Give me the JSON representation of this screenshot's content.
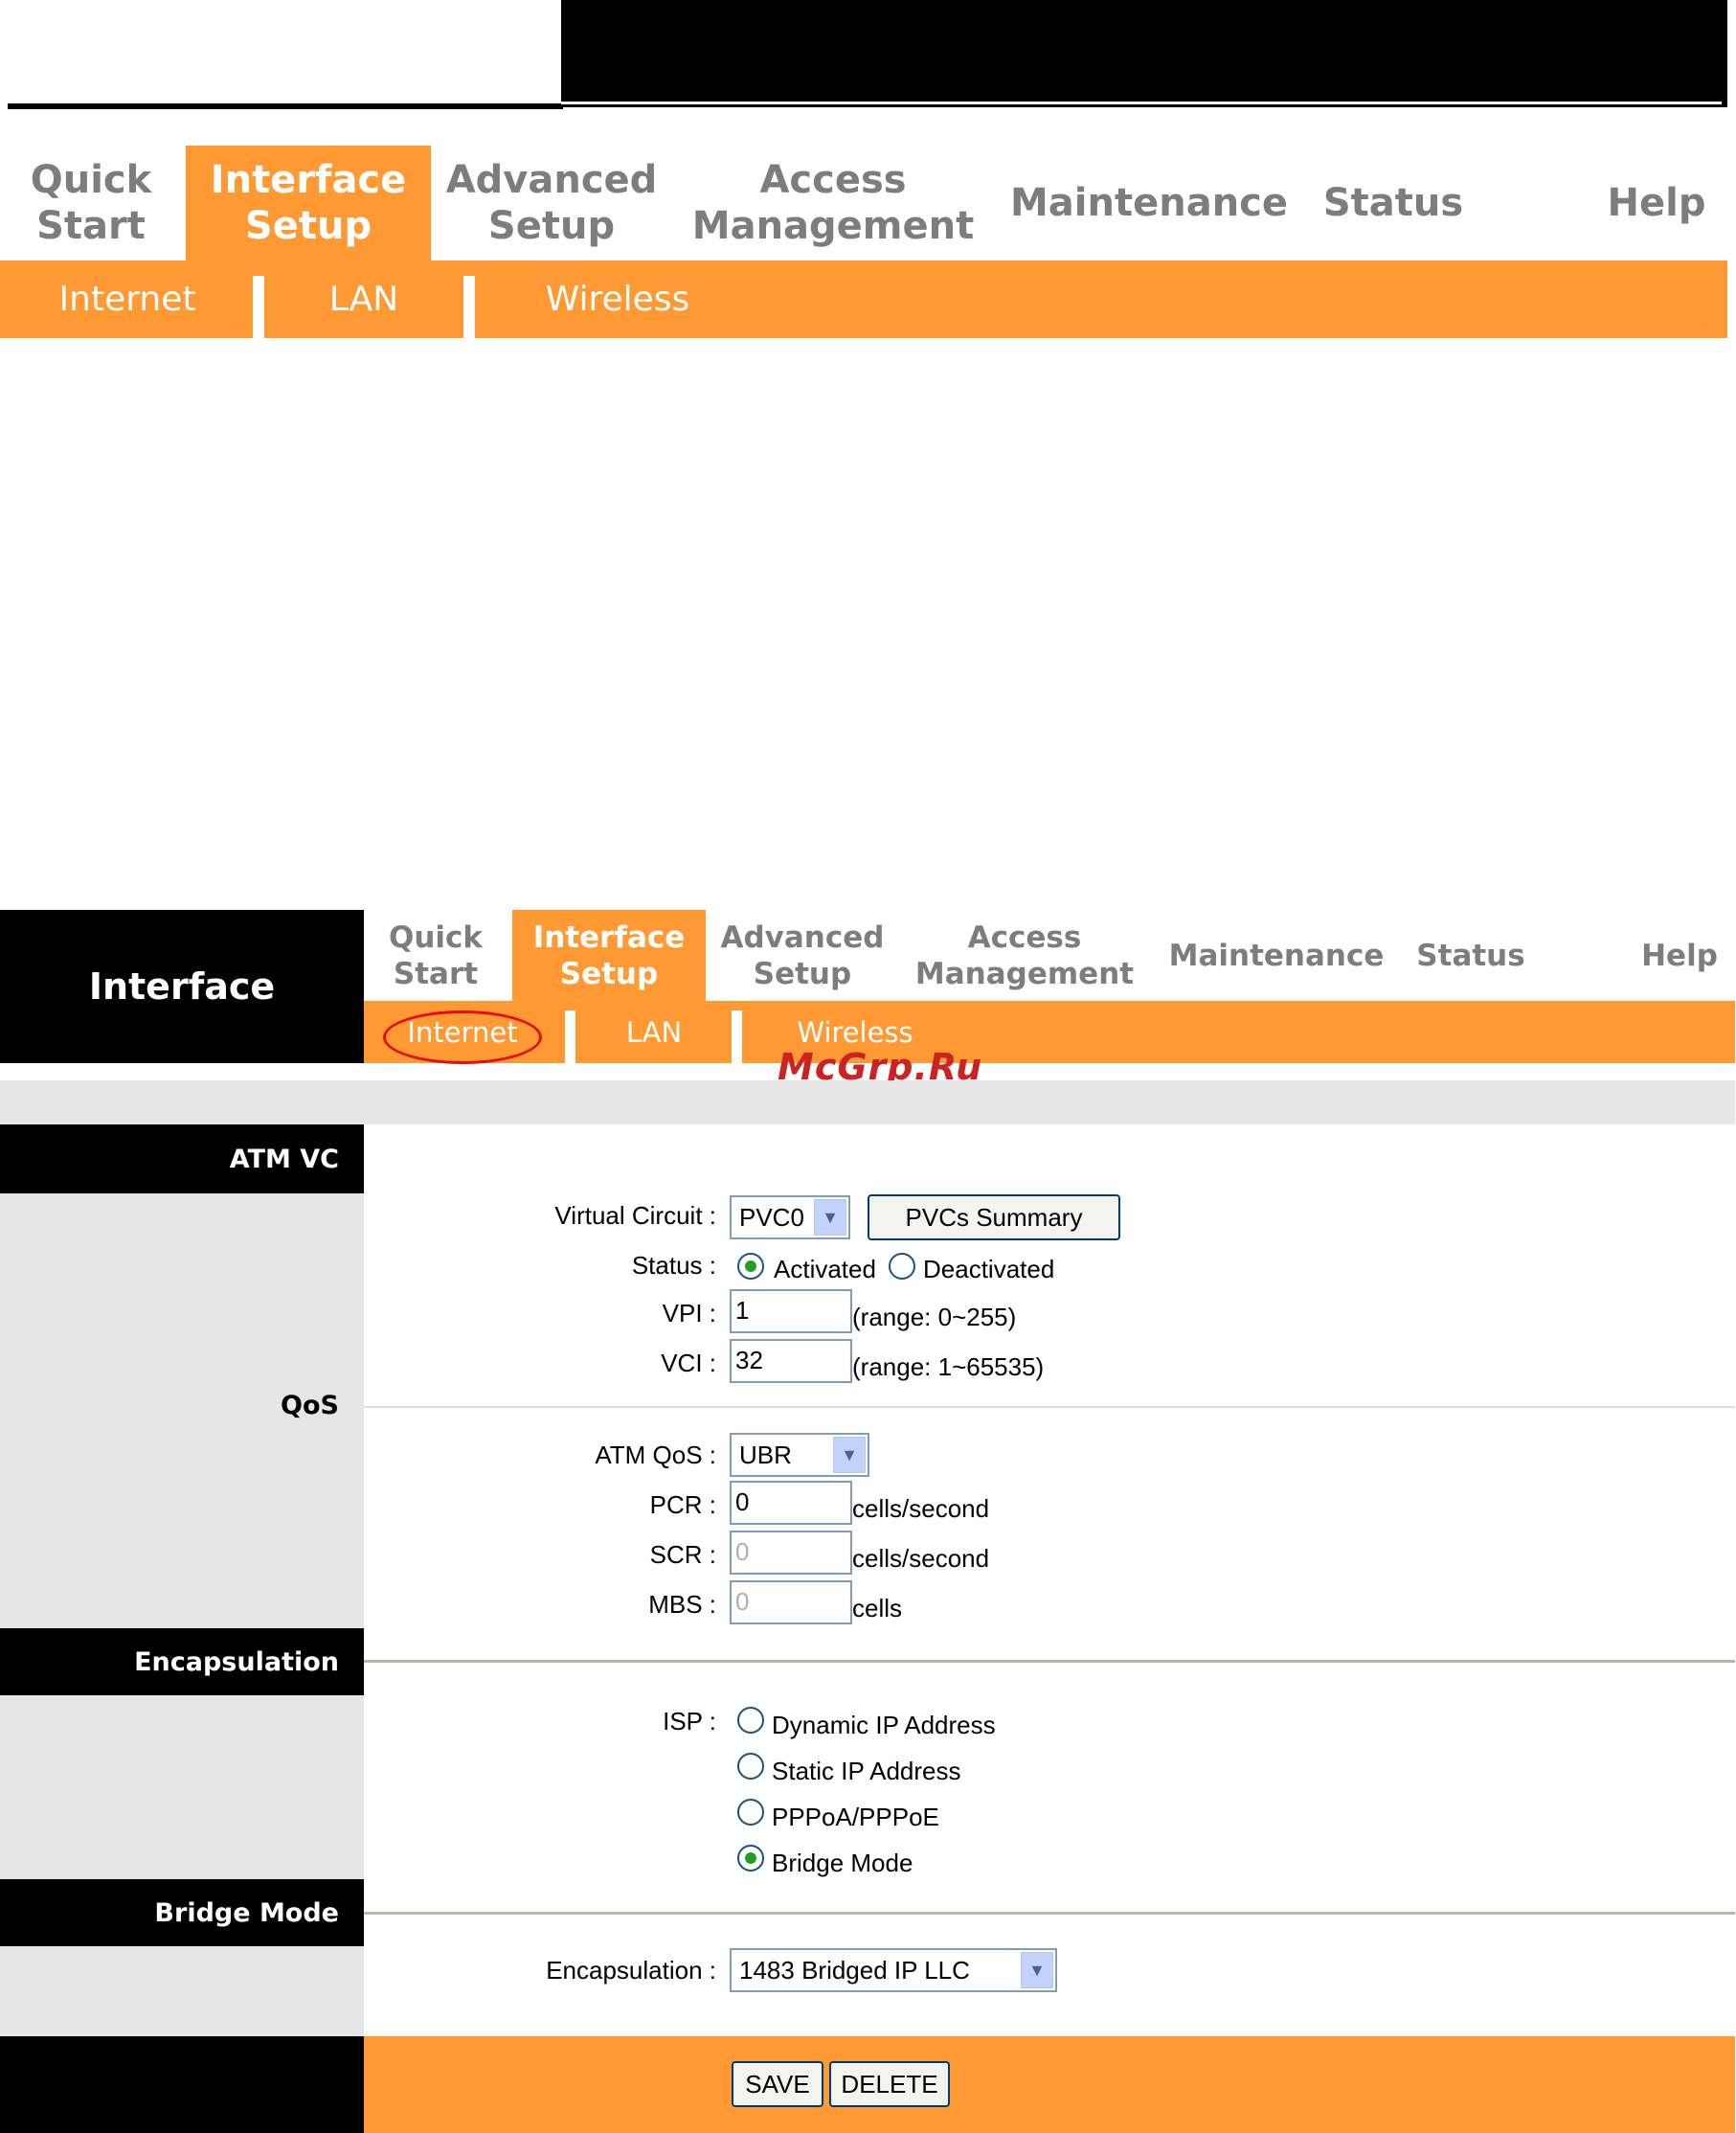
{
  "top_nav": {
    "tabs": [
      {
        "label": "Quick\nStart"
      },
      {
        "label": "Interface\nSetup"
      },
      {
        "label": "Advanced\nSetup"
      },
      {
        "label": "Access\nManagement"
      },
      {
        "label": "Maintenance"
      },
      {
        "label": "Status"
      },
      {
        "label": "Help"
      }
    ],
    "active_tab": "Interface Setup",
    "subtabs": [
      {
        "label": "Internet"
      },
      {
        "label": "LAN"
      },
      {
        "label": "Wireless"
      }
    ]
  },
  "page": {
    "title": "Interface",
    "watermark": "McGrp.Ru",
    "nav": {
      "tabs": [
        {
          "label": "Quick\nStart"
        },
        {
          "label": "Interface\nSetup"
        },
        {
          "label": "Advanced\nSetup"
        },
        {
          "label": "Access\nManagement"
        },
        {
          "label": "Maintenance"
        },
        {
          "label": "Status"
        },
        {
          "label": "Help"
        }
      ],
      "subtabs": [
        {
          "label": "Internet"
        },
        {
          "label": "LAN"
        },
        {
          "label": "Wireless"
        }
      ]
    },
    "sections": {
      "atm_vc": "ATM VC",
      "qos": "QoS",
      "encapsulation": "Encapsulation",
      "bridge_mode": "Bridge Mode"
    },
    "atm_vc": {
      "virtual_circuit_label": "Virtual Circuit :",
      "virtual_circuit_value": "PVC0",
      "pvcs_summary_button": "PVCs Summary",
      "status_label": "Status :",
      "status_activated": "Activated",
      "status_deactivated": "Deactivated",
      "status_selected": "Activated",
      "vpi_label": "VPI :",
      "vpi_value": "1",
      "vpi_range": "(range: 0~255)",
      "vci_label": "VCI :",
      "vci_value": "32",
      "vci_range": "(range: 1~65535)"
    },
    "qos": {
      "atm_qos_label": "ATM QoS :",
      "atm_qos_value": "UBR",
      "pcr_label": "PCR :",
      "pcr_value": "0",
      "pcr_unit": "cells/second",
      "scr_label": "SCR :",
      "scr_value": "0",
      "scr_unit": "cells/second",
      "mbs_label": "MBS :",
      "mbs_value": "0",
      "mbs_unit": "cells"
    },
    "encapsulation": {
      "isp_label": "ISP :",
      "options": [
        "Dynamic IP Address",
        "Static IP Address",
        "PPPoA/PPPoE",
        "Bridge Mode"
      ],
      "selected": "Bridge Mode"
    },
    "bridge_mode": {
      "encapsulation_label": "Encapsulation :",
      "encapsulation_value": "1483 Bridged IP LLC"
    },
    "footer": {
      "save_button": "SAVE",
      "delete_button": "DELETE"
    }
  },
  "colors": {
    "accent_orange": "#ff9933",
    "nav_gray_text": "#7d7d7d",
    "panel_gray": "#e6e6e6"
  }
}
